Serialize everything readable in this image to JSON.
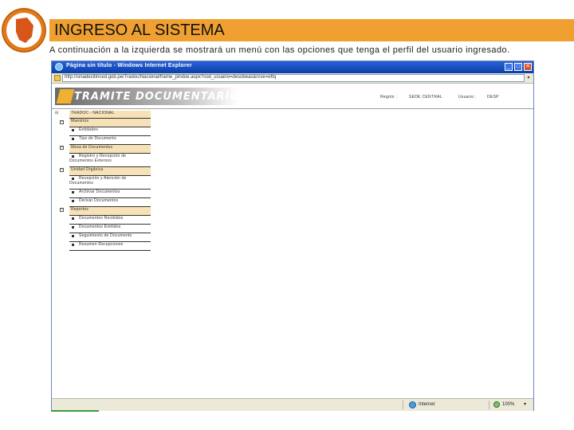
{
  "slide": {
    "title": "INGRESO AL SISTEMA",
    "subtitle": "A continuación a la izquierda se mostrará un menú con las opciones que tenga el perfil del usuario ingresado."
  },
  "browser": {
    "title": "Página sin título - Windows Internet Explorer",
    "address": "http://sinadecitinced.gob.pe/Tradoc/Nacional/frame_pindoe.aspx?cod_usuario=desobeas&rcve=eftq",
    "status_zone": "Internet",
    "zoom": "100%",
    "minimize_label": "_",
    "maximize_label": "□",
    "close_label": "✕",
    "dropdown_glyph": "▾"
  },
  "app": {
    "logo_text": "TRAMITE DOCUMENTARIO",
    "sede_label": "Región :",
    "sede_value": "SEDE CENTRAL",
    "usuario_label": "Usuario :",
    "usuario_value": "DESP"
  },
  "menu": {
    "root_glyph": "⊟",
    "title": "TRADOC - NACIONAL",
    "sections": [
      {
        "label": "Maestros",
        "expander": "−",
        "items": [
          "Entidades",
          "Tipo de Documento"
        ]
      },
      {
        "label": "Mesa de Documentos",
        "expander": "−",
        "items": [
          "Registro y Recepción de Documentos Externos"
        ]
      },
      {
        "label": "Unidad Orgánica",
        "expander": "−",
        "items": [
          "Recepción y Atención de Documentos",
          "Archivar Documentos",
          "Derivar Documentos"
        ]
      },
      {
        "label": "Reportes",
        "expander": "−",
        "items": [
          "Documentos Recibidos",
          "Documentos Emitidos",
          "Seguimiento de Documento",
          "Resumen Recepciones"
        ]
      }
    ]
  }
}
